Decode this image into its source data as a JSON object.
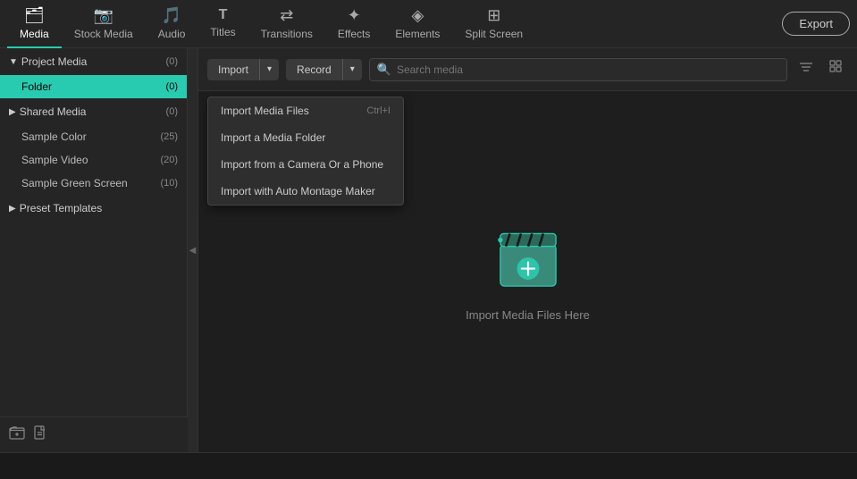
{
  "topNav": {
    "items": [
      {
        "id": "media",
        "label": "Media",
        "icon": "🗂",
        "active": true
      },
      {
        "id": "stock-media",
        "label": "Stock Media",
        "icon": "📷"
      },
      {
        "id": "audio",
        "label": "Audio",
        "icon": "🎵"
      },
      {
        "id": "titles",
        "label": "Titles",
        "icon": "T"
      },
      {
        "id": "transitions",
        "label": "Transitions",
        "icon": "⇄"
      },
      {
        "id": "effects",
        "label": "Effects",
        "icon": "✦"
      },
      {
        "id": "elements",
        "label": "Elements",
        "icon": "◈"
      },
      {
        "id": "split-screen",
        "label": "Split Screen",
        "icon": "⊞"
      }
    ],
    "exportLabel": "Export"
  },
  "sidebar": {
    "sections": [
      {
        "id": "project-media",
        "label": "Project Media",
        "count": "(0)",
        "expanded": true,
        "items": [
          {
            "id": "folder",
            "label": "Folder",
            "count": "(0)",
            "active": true
          }
        ]
      },
      {
        "id": "shared-media",
        "label": "Shared Media",
        "count": "(0)",
        "expanded": true,
        "items": [
          {
            "id": "sample-color",
            "label": "Sample Color",
            "count": "(25)"
          },
          {
            "id": "sample-video",
            "label": "Sample Video",
            "count": "(20)"
          },
          {
            "id": "sample-green-screen",
            "label": "Sample Green Screen",
            "count": "(10)"
          }
        ]
      },
      {
        "id": "preset-templates",
        "label": "Preset Templates",
        "count": "",
        "expanded": false,
        "items": []
      }
    ],
    "footerIcons": [
      {
        "id": "add-folder",
        "icon": "📁"
      },
      {
        "id": "add-file",
        "icon": "📄"
      }
    ]
  },
  "toolbar": {
    "importLabel": "Import",
    "recordLabel": "Record",
    "searchPlaceholder": "Search media"
  },
  "dropdownMenu": {
    "visible": true,
    "items": [
      {
        "id": "import-media-files",
        "label": "Import Media Files",
        "shortcut": "Ctrl+I"
      },
      {
        "id": "import-media-folder",
        "label": "Import a Media Folder",
        "shortcut": ""
      },
      {
        "id": "import-camera-phone",
        "label": "Import from a Camera Or a Phone",
        "shortcut": ""
      },
      {
        "id": "import-auto-montage",
        "label": "Import with Auto Montage Maker",
        "shortcut": ""
      }
    ]
  },
  "emptyState": {
    "label": "Import Media Files Here"
  }
}
